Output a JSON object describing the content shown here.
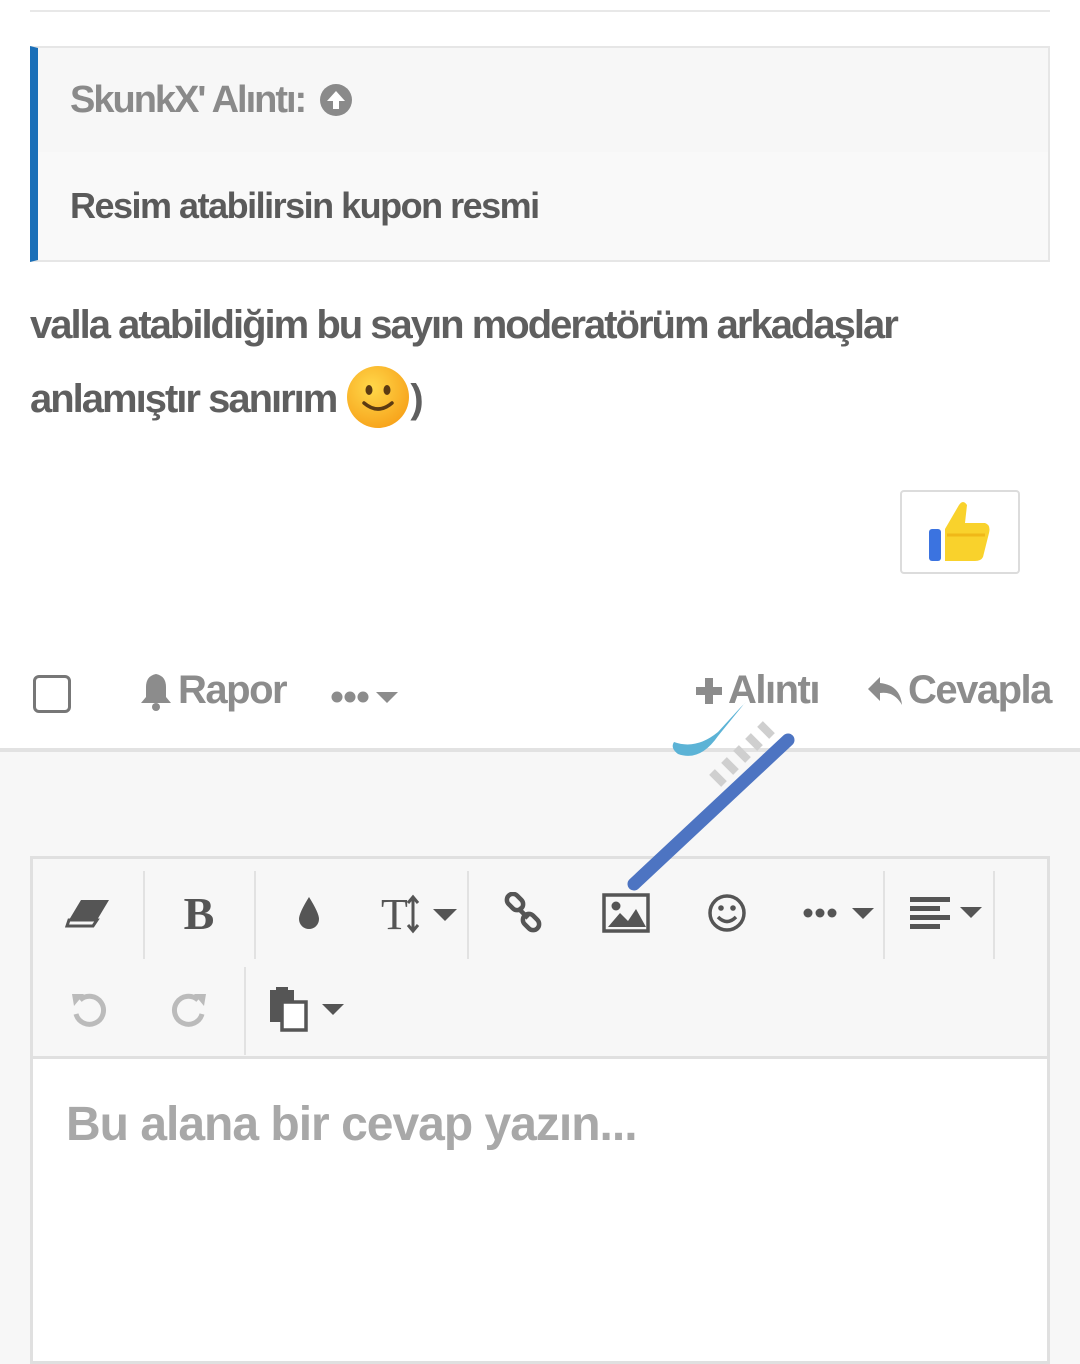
{
  "quote": {
    "author": "SkunkX' Alıntı:",
    "text": "Resim atabilirsin kupon resmi"
  },
  "message": {
    "line1": "valla atabildiğim bu sayın moderatörüm arkadaşlar",
    "line2": "anlamıştır sanırım",
    "trailing": ")"
  },
  "actions": {
    "report_label": "Rapor",
    "quote_label": "Alıntı",
    "reply_label": "Cevapla"
  },
  "editor": {
    "placeholder": "Bu alana bir cevap yazın...",
    "toolbar": [
      "eraser-icon",
      "bold-icon",
      "color-drop-icon",
      "text-size-icon",
      "link-icon",
      "image-icon",
      "emoji-icon",
      "more-icon",
      "align-icon",
      "undo-icon",
      "redo-icon",
      "paste-icon"
    ]
  },
  "colors": {
    "quote_accent": "#1a6fb8",
    "muted_text": "#8c8c8c",
    "body_text": "#5f5f5f"
  }
}
